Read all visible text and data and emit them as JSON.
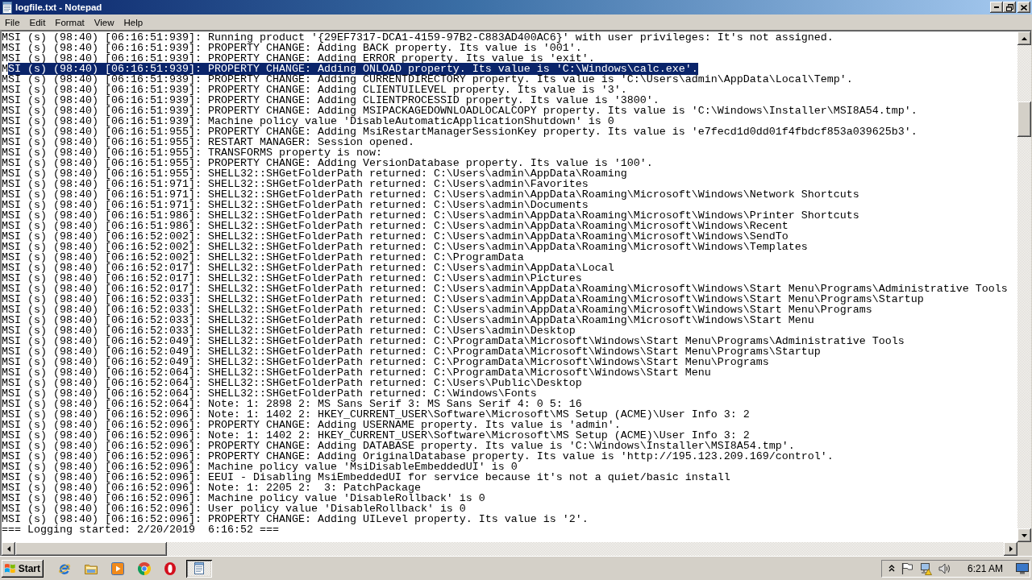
{
  "window": {
    "title": "logfile.txt - Notepad"
  },
  "menu": [
    "File",
    "Edit",
    "Format",
    "View",
    "Help"
  ],
  "editor": {
    "lines": [
      {
        "text": "MSI (s) (98:40) [06:16:51:939]: Running product '{29EF7317-DCA1-4159-97B2-C883AD400AC6}' with user privileges: It's not assigned.",
        "selected": false
      },
      {
        "text": "MSI (s) (98:40) [06:16:51:939]: PROPERTY CHANGE: Adding BACK property. Its value is '001'.",
        "selected": false
      },
      {
        "text": "MSI (s) (98:40) [06:16:51:939]: PROPERTY CHANGE: Adding ERROR property. Its value is 'exit'.",
        "selected": false
      },
      {
        "text": "M",
        "selected_text": "SI (s) (98:40) [06:16:51:939]: PROPERTY CHANGE: Adding ONLOAD property. Its value is 'C:\\Windows\\calc.exe'.",
        "selected": true
      },
      {
        "text": "MSI (s) (98:40) [06:16:51:939]: PROPERTY CHANGE: Adding CURRENTDIRECTORY property. Its value is 'C:\\Users\\admin\\AppData\\Local\\Temp'.",
        "selected": false
      },
      {
        "text": "MSI (s) (98:40) [06:16:51:939]: PROPERTY CHANGE: Adding CLIENTUILEVEL property. Its value is '3'.",
        "selected": false
      },
      {
        "text": "MSI (s) (98:40) [06:16:51:939]: PROPERTY CHANGE: Adding CLIENTPROCESSID property. Its value is '3800'.",
        "selected": false
      },
      {
        "text": "MSI (s) (98:40) [06:16:51:939]: PROPERTY CHANGE: Adding MSIPACKAGEDOWNLOADLOCALCOPY property. Its value is 'C:\\Windows\\Installer\\MSI8A54.tmp'.",
        "selected": false
      },
      {
        "text": "MSI (s) (98:40) [06:16:51:939]: Machine policy value 'DisableAutomaticApplicationShutdown' is 0",
        "selected": false
      },
      {
        "text": "MSI (s) (98:40) [06:16:51:955]: PROPERTY CHANGE: Adding MsiRestartManagerSessionKey property. Its value is 'e7fecd1d0dd01f4fbdcf853a039625b3'.",
        "selected": false
      },
      {
        "text": "MSI (s) (98:40) [06:16:51:955]: RESTART MANAGER: Session opened.",
        "selected": false
      },
      {
        "text": "MSI (s) (98:40) [06:16:51:955]: TRANSFORMS property is now:",
        "selected": false
      },
      {
        "text": "MSI (s) (98:40) [06:16:51:955]: PROPERTY CHANGE: Adding VersionDatabase property. Its value is '100'.",
        "selected": false
      },
      {
        "text": "MSI (s) (98:40) [06:16:51:955]: SHELL32::SHGetFolderPath returned: C:\\Users\\admin\\AppData\\Roaming",
        "selected": false
      },
      {
        "text": "MSI (s) (98:40) [06:16:51:971]: SHELL32::SHGetFolderPath returned: C:\\Users\\admin\\Favorites",
        "selected": false
      },
      {
        "text": "MSI (s) (98:40) [06:16:51:971]: SHELL32::SHGetFolderPath returned: C:\\Users\\admin\\AppData\\Roaming\\Microsoft\\Windows\\Network Shortcuts",
        "selected": false
      },
      {
        "text": "MSI (s) (98:40) [06:16:51:971]: SHELL32::SHGetFolderPath returned: C:\\Users\\admin\\Documents",
        "selected": false
      },
      {
        "text": "MSI (s) (98:40) [06:16:51:986]: SHELL32::SHGetFolderPath returned: C:\\Users\\admin\\AppData\\Roaming\\Microsoft\\Windows\\Printer Shortcuts",
        "selected": false
      },
      {
        "text": "MSI (s) (98:40) [06:16:51:986]: SHELL32::SHGetFolderPath returned: C:\\Users\\admin\\AppData\\Roaming\\Microsoft\\Windows\\Recent",
        "selected": false
      },
      {
        "text": "MSI (s) (98:40) [06:16:52:002]: SHELL32::SHGetFolderPath returned: C:\\Users\\admin\\AppData\\Roaming\\Microsoft\\Windows\\SendTo",
        "selected": false
      },
      {
        "text": "MSI (s) (98:40) [06:16:52:002]: SHELL32::SHGetFolderPath returned: C:\\Users\\admin\\AppData\\Roaming\\Microsoft\\Windows\\Templates",
        "selected": false
      },
      {
        "text": "MSI (s) (98:40) [06:16:52:002]: SHELL32::SHGetFolderPath returned: C:\\ProgramData",
        "selected": false
      },
      {
        "text": "MSI (s) (98:40) [06:16:52:017]: SHELL32::SHGetFolderPath returned: C:\\Users\\admin\\AppData\\Local",
        "selected": false
      },
      {
        "text": "MSI (s) (98:40) [06:16:52:017]: SHELL32::SHGetFolderPath returned: C:\\Users\\admin\\Pictures",
        "selected": false
      },
      {
        "text": "MSI (s) (98:40) [06:16:52:017]: SHELL32::SHGetFolderPath returned: C:\\Users\\admin\\AppData\\Roaming\\Microsoft\\Windows\\Start Menu\\Programs\\Administrative Tools",
        "selected": false
      },
      {
        "text": "MSI (s) (98:40) [06:16:52:033]: SHELL32::SHGetFolderPath returned: C:\\Users\\admin\\AppData\\Roaming\\Microsoft\\Windows\\Start Menu\\Programs\\Startup",
        "selected": false
      },
      {
        "text": "MSI (s) (98:40) [06:16:52:033]: SHELL32::SHGetFolderPath returned: C:\\Users\\admin\\AppData\\Roaming\\Microsoft\\Windows\\Start Menu\\Programs",
        "selected": false
      },
      {
        "text": "MSI (s) (98:40) [06:16:52:033]: SHELL32::SHGetFolderPath returned: C:\\Users\\admin\\AppData\\Roaming\\Microsoft\\Windows\\Start Menu",
        "selected": false
      },
      {
        "text": "MSI (s) (98:40) [06:16:52:033]: SHELL32::SHGetFolderPath returned: C:\\Users\\admin\\Desktop",
        "selected": false
      },
      {
        "text": "MSI (s) (98:40) [06:16:52:049]: SHELL32::SHGetFolderPath returned: C:\\ProgramData\\Microsoft\\Windows\\Start Menu\\Programs\\Administrative Tools",
        "selected": false
      },
      {
        "text": "MSI (s) (98:40) [06:16:52:049]: SHELL32::SHGetFolderPath returned: C:\\ProgramData\\Microsoft\\Windows\\Start Menu\\Programs\\Startup",
        "selected": false
      },
      {
        "text": "MSI (s) (98:40) [06:16:52:049]: SHELL32::SHGetFolderPath returned: C:\\ProgramData\\Microsoft\\Windows\\Start Menu\\Programs",
        "selected": false
      },
      {
        "text": "MSI (s) (98:40) [06:16:52:064]: SHELL32::SHGetFolderPath returned: C:\\ProgramData\\Microsoft\\Windows\\Start Menu",
        "selected": false
      },
      {
        "text": "MSI (s) (98:40) [06:16:52:064]: SHELL32::SHGetFolderPath returned: C:\\Users\\Public\\Desktop",
        "selected": false
      },
      {
        "text": "MSI (s) (98:40) [06:16:52:064]: SHELL32::SHGetFolderPath returned: C:\\Windows\\Fonts",
        "selected": false
      },
      {
        "text": "MSI (s) (98:40) [06:16:52:064]: Note: 1: 2898 2: MS Sans Serif 3: MS Sans Serif 4: 0 5: 16",
        "selected": false
      },
      {
        "text": "MSI (s) (98:40) [06:16:52:096]: Note: 1: 1402 2: HKEY_CURRENT_USER\\Software\\Microsoft\\MS Setup (ACME)\\User Info 3: 2",
        "selected": false
      },
      {
        "text": "MSI (s) (98:40) [06:16:52:096]: PROPERTY CHANGE: Adding USERNAME property. Its value is 'admin'.",
        "selected": false
      },
      {
        "text": "MSI (s) (98:40) [06:16:52:096]: Note: 1: 1402 2: HKEY_CURRENT_USER\\Software\\Microsoft\\MS Setup (ACME)\\User Info 3: 2",
        "selected": false
      },
      {
        "text": "MSI (s) (98:40) [06:16:52:096]: PROPERTY CHANGE: Adding DATABASE property. Its value is 'C:\\Windows\\Installer\\MSI8A54.tmp'.",
        "selected": false
      },
      {
        "text": "MSI (s) (98:40) [06:16:52:096]: PROPERTY CHANGE: Adding OriginalDatabase property. Its value is 'http://195.123.209.169/control'.",
        "selected": false
      },
      {
        "text": "MSI (s) (98:40) [06:16:52:096]: Machine policy value 'MsiDisableEmbeddedUI' is 0",
        "selected": false
      },
      {
        "text": "MSI (s) (98:40) [06:16:52:096]: EEUI - Disabling MsiEmbeddedUI for service because it's not a quiet/basic install",
        "selected": false
      },
      {
        "text": "MSI (s) (98:40) [06:16:52:096]: Note: 1: 2205 2:  3: PatchPackage",
        "selected": false
      },
      {
        "text": "MSI (s) (98:40) [06:16:52:096]: Machine policy value 'DisableRollback' is 0",
        "selected": false
      },
      {
        "text": "MSI (s) (98:40) [06:16:52:096]: User policy value 'DisableRollback' is 0",
        "selected": false
      },
      {
        "text": "MSI (s) (98:40) [06:16:52:096]: PROPERTY CHANGE: Adding UILevel property. Its value is '2'.",
        "selected": false
      },
      {
        "text": "=== Logging started: 2/20/2019  6:16:52 ===",
        "selected": false
      }
    ]
  },
  "taskbar": {
    "start": "Start",
    "tasks": [
      {
        "selected": true
      }
    ],
    "clock": "6:21 AM"
  }
}
